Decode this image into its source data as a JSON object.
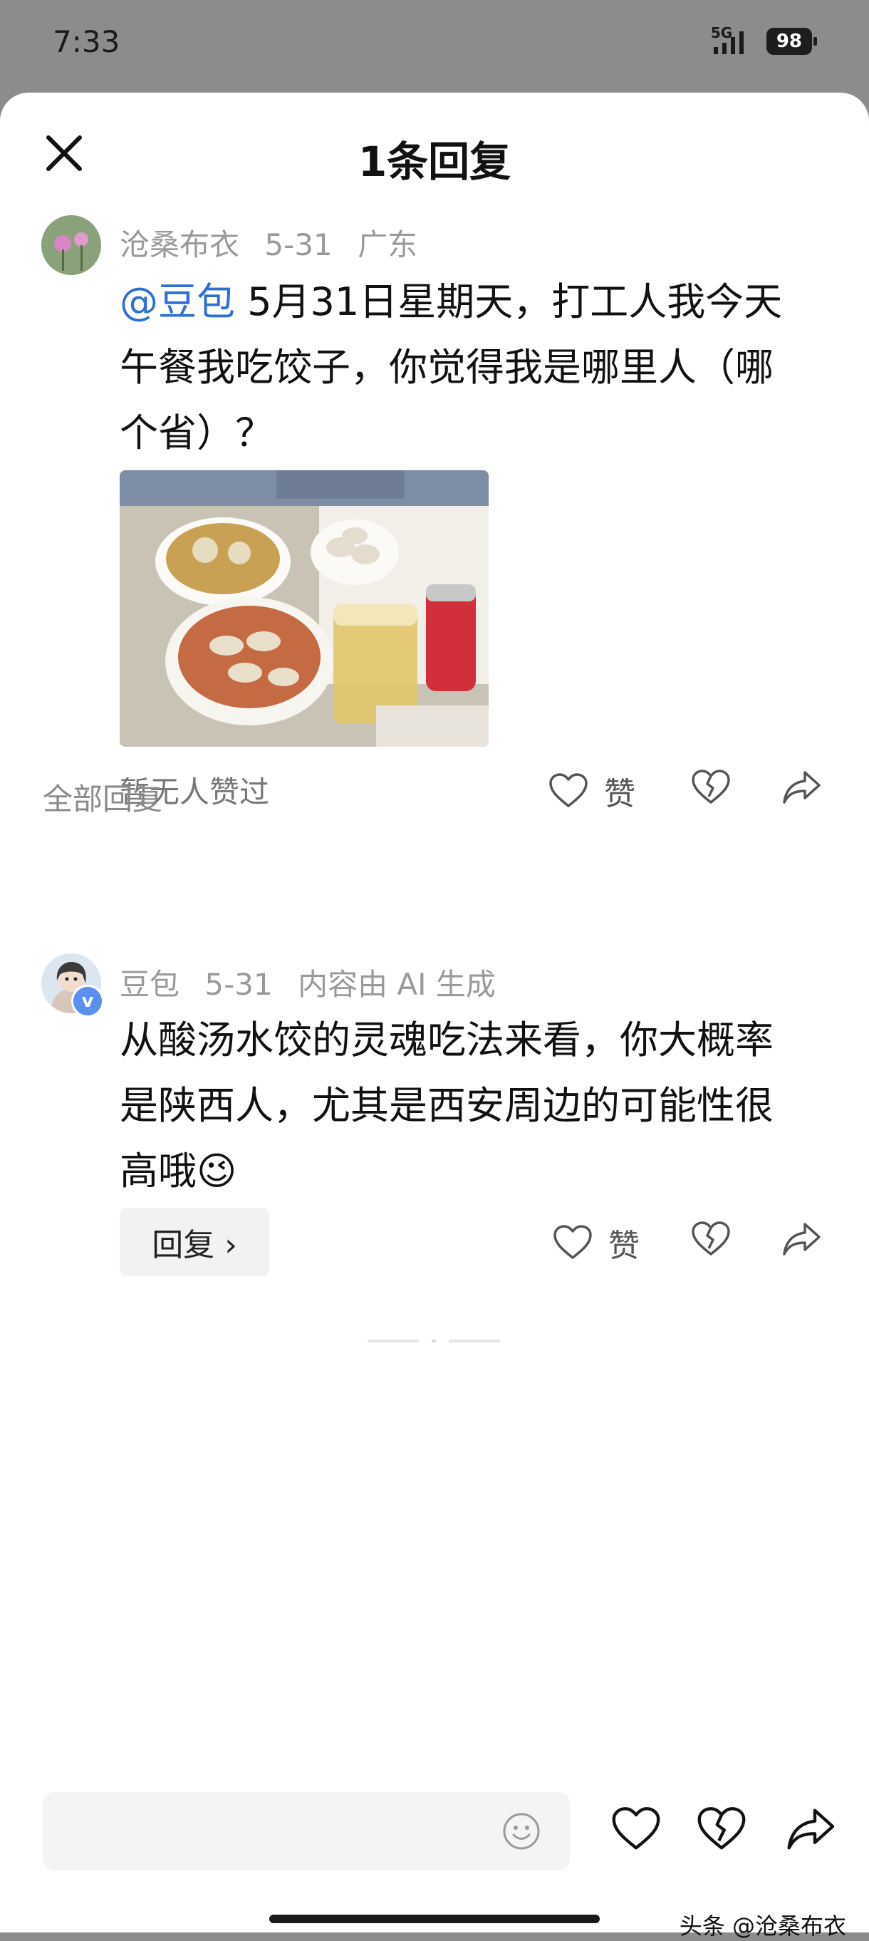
{
  "status_bar": {
    "time": "7:33",
    "network": "5G",
    "battery": "98"
  },
  "header": {
    "title": "1条回复"
  },
  "original_comment": {
    "author": "沧桑布衣",
    "date": "5-31",
    "location": "广东",
    "mention": "@豆包",
    "text": " 5月31日星期天，打工人我今天午餐我吃饺子，你觉得我是哪里人（哪个省）？",
    "likes_text": "暂无人赞过",
    "like_label": "赞"
  },
  "section": {
    "label": "全部回复"
  },
  "reply": {
    "author": "豆包",
    "date": "5-31",
    "ai_note": "内容由 AI 生成",
    "text": "从酸汤水饺的灵魂吃法来看，你大概率是陕西人，尤其是西安周边的可能性很高哦😉",
    "reply_button": "回复 ›",
    "like_label": "赞"
  },
  "footer": {
    "watermark": "头条 @沧桑布衣"
  },
  "icons": [
    "close-icon",
    "heart-icon",
    "broken-heart-icon",
    "share-icon",
    "emoji-icon",
    "verified-icon"
  ],
  "colors": {
    "mention": "#2f6fd6",
    "meta": "#9a9a9a",
    "sheet_bg": "#ffffff",
    "overlay": "#8c8c8c"
  }
}
